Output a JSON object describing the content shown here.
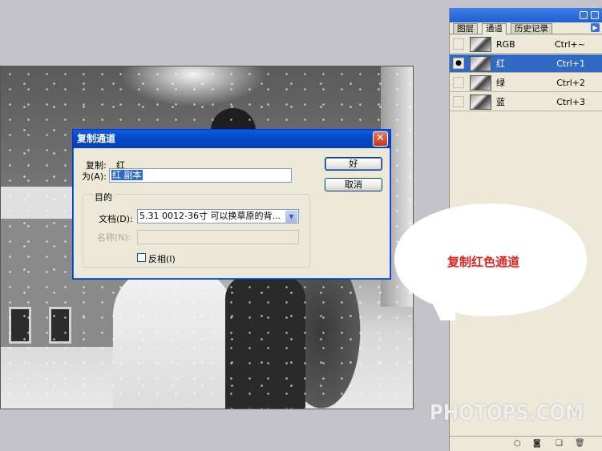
{
  "dialog": {
    "title": "复制通道",
    "source_label": "复制:",
    "source_value": "红",
    "as_label": "为(A):",
    "as_value": "红 副本",
    "ok_label": "好",
    "cancel_label": "取消",
    "destination_legend": "目的",
    "document_label": "文档(D):",
    "document_value": "5.31  0012-36寸 可以换草原的背...",
    "name_label": "名称(N):",
    "name_value": "",
    "invert_label": "反相(I)",
    "invert_checked": false
  },
  "panel": {
    "tabs": [
      "图层",
      "通道",
      "历史记录"
    ],
    "active_tab": "通道",
    "channels": [
      {
        "name": "RGB",
        "shortcut": "Ctrl+~",
        "visible": false,
        "selected": false
      },
      {
        "name": "红",
        "shortcut": "Ctrl+1",
        "visible": true,
        "selected": true
      },
      {
        "name": "绿",
        "shortcut": "Ctrl+2",
        "visible": false,
        "selected": false
      },
      {
        "name": "蓝",
        "shortcut": "Ctrl+3",
        "visible": false,
        "selected": false
      }
    ],
    "footer_icons": [
      "load-selection-icon",
      "save-selection-icon",
      "new-channel-icon",
      "delete-channel-icon"
    ]
  },
  "callout": {
    "text": "复制红色通道"
  },
  "watermark": {
    "text": "PHOTOPS.COM"
  },
  "colors": {
    "selection_blue": "#316ac5",
    "callout_text": "#e0231f",
    "titlebar_blue": "#0648c8"
  }
}
